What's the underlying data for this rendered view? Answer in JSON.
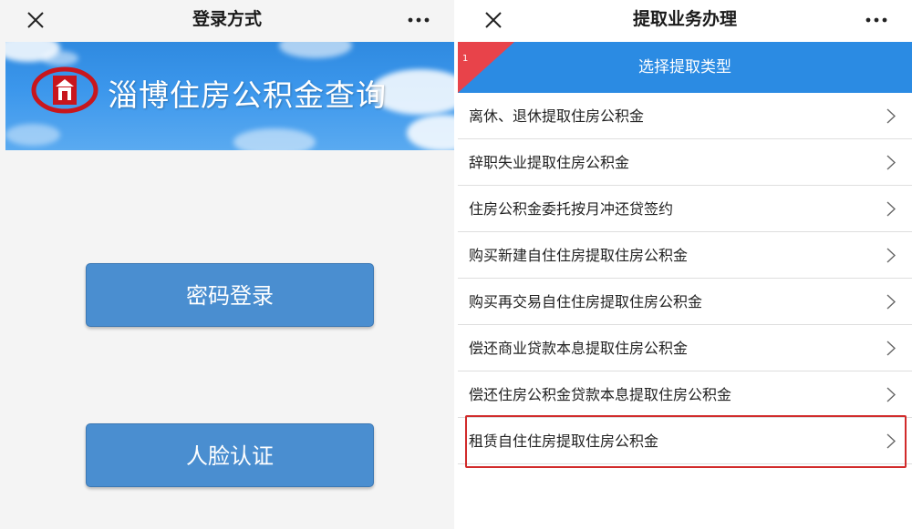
{
  "left": {
    "nav": {
      "title": "登录方式"
    },
    "banner": {
      "title": "淄博住房公积金查询"
    },
    "buttons": {
      "password_login": "密码登录",
      "face_auth": "人脸认证"
    }
  },
  "right": {
    "nav": {
      "title": "提取业务办理"
    },
    "header": {
      "label": "选择提取类型",
      "corner_number": "1"
    },
    "items": [
      {
        "label": "离休、退休提取住房公积金"
      },
      {
        "label": "辞职失业提取住房公积金"
      },
      {
        "label": "住房公积金委托按月冲还贷签约"
      },
      {
        "label": "购买新建自住住房提取住房公积金"
      },
      {
        "label": "购买再交易自住住房提取住房公积金"
      },
      {
        "label": "偿还商业贷款本息提取住房公积金"
      },
      {
        "label": "偿还住房公积金贷款本息提取住房公积金"
      },
      {
        "label": "租赁自住住房提取住房公积金"
      }
    ],
    "highlighted_item_index": 7
  },
  "colors": {
    "banner_blue": "#3c97ec",
    "button_blue": "#4a8ed0",
    "header_blue": "#2b8be3",
    "corner_red": "#e8434a",
    "highlight_red": "#d12b2b"
  },
  "icons": {
    "close": "close-icon",
    "more": "more-icon",
    "chevron": "chevron-right-icon",
    "logo": "housing-fund-logo"
  }
}
